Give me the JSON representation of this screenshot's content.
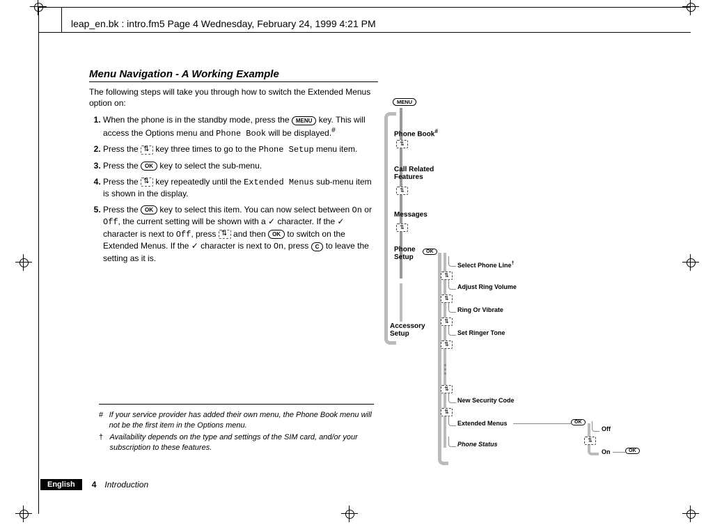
{
  "header": "leap_en.bk : intro.fm5  Page 4  Wednesday, February 24, 1999  4:21 PM",
  "title": "Menu Navigation - A Working Example",
  "intro": "The following steps will take you through how to switch the Extended Menus option on:",
  "keys": {
    "menu": "MENU",
    "ok": "OK",
    "c": "C"
  },
  "lcd": {
    "phone_book": "Phone Book",
    "phone_setup": "Phone Setup",
    "extended_menus": "Extended Menus",
    "on": "On",
    "off": "Off"
  },
  "steps": {
    "s1a": "When the phone is in the standby mode, press the ",
    "s1b": " key. This will access the Options menu and ",
    "s1c": " will be displayed.",
    "s1hash": "#",
    "s2a": "Press the ",
    "s2b": " key three times to go to the ",
    "s2c": " menu item.",
    "s3a": "Press the ",
    "s3b": " key to select the sub-menu.",
    "s4a": "Press the ",
    "s4b": " key repeatedly until the ",
    "s4c": " sub-menu item is shown in the display.",
    "s5a": "Press the ",
    "s5b": " key to select this item. You can now select between ",
    "s5c": " or ",
    "s5d": ", the current setting will be shown with a ",
    "s5e": " character. If the ",
    "s5f": " character is next to ",
    "s5g": ", press ",
    "s5h": " and then ",
    "s5i": " to switch on the Extended Menus. If the ",
    "s5j": " character is next to ",
    "s5k": ", press ",
    "s5l": " to leave the setting as it is."
  },
  "footnotes": {
    "m1": "#",
    "t1": "If your service provider has added their own menu, the Phone Book menu will not be the first item in the Options menu.",
    "m2": "†",
    "t2": "Availability depends on the type and settings of the SIM card, and/or your subscription to these features."
  },
  "footer": {
    "lang": "English",
    "page": "4",
    "section": "Introduction"
  },
  "diagram": {
    "menu": "MENU",
    "items": {
      "phone_book": "Phone Book",
      "call_related": "Call Related Features",
      "messages": "Messages",
      "phone_setup": "Phone Setup",
      "accessory_setup": "Accessory Setup"
    },
    "hash": "#",
    "dagger": "†",
    "sub": {
      "select_line": "Select Phone Line",
      "adjust_ring": "Adjust Ring Volume",
      "ring_vibrate": "Ring Or Vibrate",
      "set_ringer": "Set Ringer Tone",
      "new_sec": "New Security Code",
      "ext_menus": "Extended Menus",
      "phone_status": "Phone Status"
    },
    "onoff": {
      "off": "Off",
      "on": "On"
    },
    "ok": "OK"
  }
}
